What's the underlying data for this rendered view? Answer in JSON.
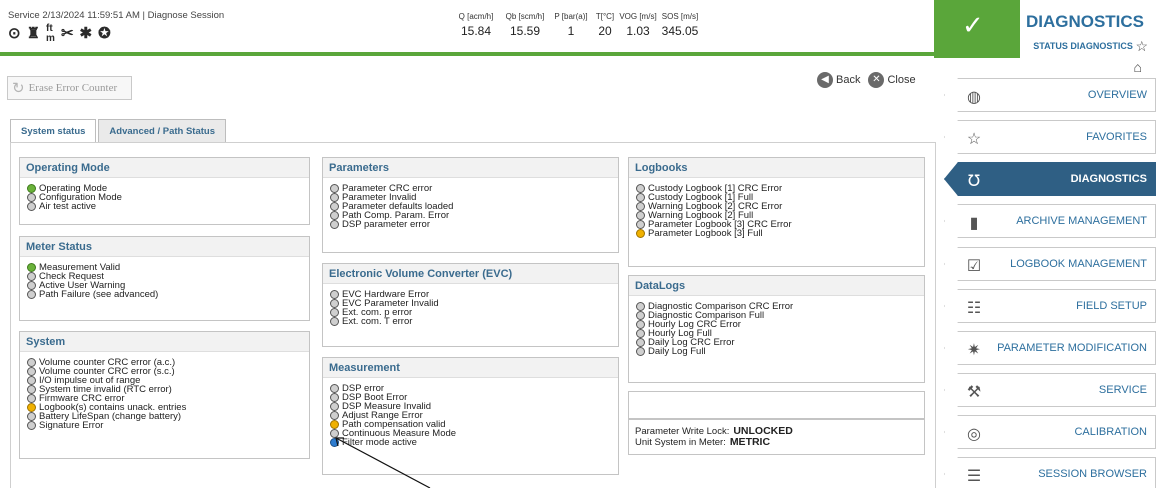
{
  "header": {
    "session": "Service  2/13/2024 11:59:51 AM | Diagnose Session",
    "measurements": [
      {
        "label": "Q [acm/h]",
        "value": "15.84"
      },
      {
        "label": "Qb [scm/h]",
        "value": "15.59"
      },
      {
        "label": "P [bar(a)]",
        "value": "1"
      },
      {
        "label": "T[°C]",
        "value": "20"
      },
      {
        "label": "VOG [m/s]",
        "value": "1.03"
      },
      {
        "label": "SOS [m/s]",
        "value": "345.05"
      }
    ],
    "status_color": "#5aa63a",
    "title": "DIAGNOSTICS",
    "subtitle": "STATUS DIAGNOSTICS"
  },
  "toolbar": {
    "erase_label": "Erase Error Counter",
    "back_label": "Back",
    "close_label": "Close"
  },
  "tabs": [
    {
      "label": "System status",
      "active": true
    },
    {
      "label": "Advanced / Path Status",
      "active": false
    }
  ],
  "groups": {
    "operating_mode": {
      "title": "Operating Mode",
      "items": [
        {
          "label": "Operating Mode",
          "state": "green"
        },
        {
          "label": "Configuration Mode",
          "state": "off"
        },
        {
          "label": "Air test active",
          "state": "off"
        }
      ]
    },
    "meter_status": {
      "title": "Meter Status",
      "items": [
        {
          "label": "Measurement Valid",
          "state": "green"
        },
        {
          "label": "Check Request",
          "state": "off"
        },
        {
          "label": "Active User Warning",
          "state": "off"
        },
        {
          "label": "Path Failure (see advanced)",
          "state": "off"
        }
      ]
    },
    "system": {
      "title": "System",
      "items": [
        {
          "label": "Volume counter CRC error (a.c.)",
          "state": "off"
        },
        {
          "label": "Volume counter CRC error (s.c.)",
          "state": "off"
        },
        {
          "label": "I/O impulse out of range",
          "state": "off"
        },
        {
          "label": "System time invalid (RTC error)",
          "state": "off"
        },
        {
          "label": "Firmware CRC error",
          "state": "off"
        },
        {
          "label": "Logbook(s) contains unack. entries",
          "state": "yellow"
        },
        {
          "label": "Battery LifeSpan (change battery)",
          "state": "off"
        },
        {
          "label": "Signature Error",
          "state": "off"
        }
      ]
    },
    "parameters": {
      "title": "Parameters",
      "items": [
        {
          "label": "Parameter CRC error",
          "state": "off"
        },
        {
          "label": "Parameter Invalid",
          "state": "off"
        },
        {
          "label": "Parameter defaults loaded",
          "state": "off"
        },
        {
          "label": "Path Comp. Param. Error",
          "state": "off"
        },
        {
          "label": "DSP parameter error",
          "state": "off"
        }
      ]
    },
    "evc": {
      "title": "Electronic Volume Converter (EVC)",
      "items": [
        {
          "label": "EVC Hardware Error",
          "state": "off"
        },
        {
          "label": "EVC Parameter Invalid",
          "state": "off"
        },
        {
          "label": "Ext. com. p error",
          "state": "off"
        },
        {
          "label": "Ext. com. T error",
          "state": "off"
        }
      ]
    },
    "measurement": {
      "title": "Measurement",
      "items": [
        {
          "label": "DSP error",
          "state": "off"
        },
        {
          "label": "DSP Boot Error",
          "state": "off"
        },
        {
          "label": "DSP Measure Invalid",
          "state": "off"
        },
        {
          "label": "Adjust Range Error",
          "state": "off"
        },
        {
          "label": "Path compensation valid",
          "state": "yellow"
        },
        {
          "label": "Continuous Measure Mode",
          "state": "off"
        },
        {
          "label": "Filter mode active",
          "state": "blue"
        }
      ]
    },
    "logbooks": {
      "title": "Logbooks",
      "items": [
        {
          "label": "Custody Logbook [1] CRC Error",
          "state": "off"
        },
        {
          "label": "Custody Logbook [1] Full",
          "state": "off"
        },
        {
          "label": "Warning Logbook [2] CRC Error",
          "state": "off"
        },
        {
          "label": "Warning Logbook [2] Full",
          "state": "off"
        },
        {
          "label": "Parameter Logbook [3] CRC Error",
          "state": "off"
        },
        {
          "label": "Parameter Logbook [3]  Full",
          "state": "yellow"
        }
      ]
    },
    "datalogs": {
      "title": "DataLogs",
      "items": [
        {
          "label": "Diagnostic Comparison CRC Error",
          "state": "off"
        },
        {
          "label": "Diagnostic Comparison Full",
          "state": "off"
        },
        {
          "label": "Hourly Log CRC Error",
          "state": "off"
        },
        {
          "label": "Hourly Log Full",
          "state": "off"
        },
        {
          "label": "Daily Log CRC Error",
          "state": "off"
        },
        {
          "label": "Daily Log Full",
          "state": "off"
        }
      ]
    }
  },
  "lock_info": {
    "write_lock_label": "Parameter Write Lock:",
    "write_lock_value": "UNLOCKED",
    "unit_label": "Unit System in Meter:",
    "unit_value": "METRIC"
  },
  "sidebar": [
    {
      "label": "OVERVIEW",
      "icon": "globe-icon",
      "active": false
    },
    {
      "label": "FAVORITES",
      "icon": "star-icon",
      "active": false
    },
    {
      "label": "DIAGNOSTICS",
      "icon": "stethoscope-icon",
      "active": true
    },
    {
      "label": "ARCHIVE MANAGEMENT",
      "icon": "archive-icon",
      "active": false
    },
    {
      "label": "LOGBOOK MANAGEMENT",
      "icon": "logbook-icon",
      "active": false
    },
    {
      "label": "FIELD SETUP",
      "icon": "field-setup-icon",
      "active": false
    },
    {
      "label": "PARAMETER MODIFICATION",
      "icon": "gear-icon",
      "active": false
    },
    {
      "label": "SERVICE",
      "icon": "wrench-icon",
      "active": false
    },
    {
      "label": "CALIBRATION",
      "icon": "calibration-icon",
      "active": false
    },
    {
      "label": "SESSION BROWSER",
      "icon": "session-browser-icon",
      "active": false
    }
  ]
}
